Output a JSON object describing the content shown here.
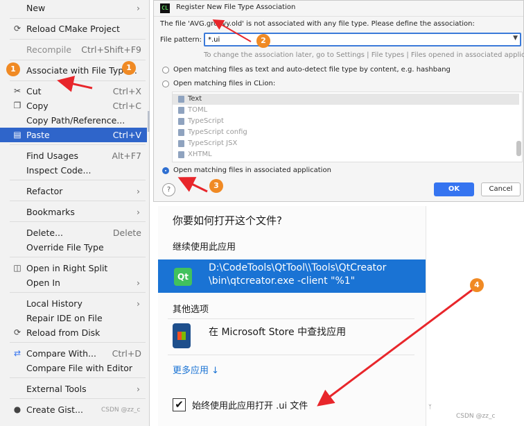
{
  "menu": {
    "items": [
      {
        "label": "New",
        "shortcut": "",
        "icon": "",
        "arrow": false,
        "disabled": false,
        "selected": false
      },
      {
        "label": "Reload CMake Project",
        "shortcut": "",
        "icon": "reload-icon",
        "arrow": false,
        "disabled": false,
        "selected": false
      },
      {
        "label": "Recompile",
        "shortcut": "Ctrl+Shift+F9",
        "icon": "",
        "arrow": false,
        "disabled": true,
        "selected": false
      },
      {
        "label": "Associate with File Type...",
        "shortcut": "",
        "icon": "",
        "arrow": false,
        "disabled": false,
        "selected": false
      },
      {
        "label": "Cut",
        "shortcut": "Ctrl+X",
        "icon": "scissors-icon",
        "arrow": false,
        "disabled": false,
        "selected": false
      },
      {
        "label": "Copy",
        "shortcut": "Ctrl+C",
        "icon": "copy-icon",
        "arrow": false,
        "disabled": false,
        "selected": false
      },
      {
        "label": "Copy Path/Reference...",
        "shortcut": "",
        "icon": "",
        "arrow": false,
        "disabled": false,
        "selected": false
      },
      {
        "label": "Paste",
        "shortcut": "Ctrl+V",
        "icon": "paste-icon",
        "arrow": false,
        "disabled": false,
        "selected": true
      },
      {
        "label": "Find Usages",
        "shortcut": "Alt+F7",
        "icon": "",
        "arrow": false,
        "disabled": false,
        "selected": false
      },
      {
        "label": "Inspect Code...",
        "shortcut": "",
        "icon": "",
        "arrow": false,
        "disabled": false,
        "selected": false
      },
      {
        "label": "Refactor",
        "shortcut": "",
        "icon": "",
        "arrow": true,
        "disabled": false,
        "selected": false
      },
      {
        "label": "Bookmarks",
        "shortcut": "",
        "icon": "",
        "arrow": true,
        "disabled": false,
        "selected": false
      },
      {
        "label": "Delete...",
        "shortcut": "Delete",
        "icon": "",
        "arrow": false,
        "disabled": false,
        "selected": false
      },
      {
        "label": "Override File Type",
        "shortcut": "",
        "icon": "",
        "arrow": false,
        "disabled": false,
        "selected": false
      },
      {
        "label": "Open in Right Split",
        "shortcut": "",
        "icon": "split-icon",
        "arrow": false,
        "disabled": false,
        "selected": false
      },
      {
        "label": "Open In",
        "shortcut": "",
        "icon": "",
        "arrow": true,
        "disabled": false,
        "selected": false
      },
      {
        "label": "Local History",
        "shortcut": "",
        "icon": "",
        "arrow": true,
        "disabled": false,
        "selected": false
      },
      {
        "label": "Repair IDE on File",
        "shortcut": "",
        "icon": "",
        "arrow": false,
        "disabled": false,
        "selected": false
      },
      {
        "label": "Reload from Disk",
        "shortcut": "",
        "icon": "reload-icon",
        "arrow": false,
        "disabled": false,
        "selected": false
      },
      {
        "label": "Compare With...",
        "shortcut": "Ctrl+D",
        "icon": "compare-icon",
        "arrow": false,
        "disabled": false,
        "selected": false
      },
      {
        "label": "Compare File with Editor",
        "shortcut": "",
        "icon": "",
        "arrow": false,
        "disabled": false,
        "selected": false
      },
      {
        "label": "External Tools",
        "shortcut": "",
        "icon": "",
        "arrow": true,
        "disabled": false,
        "selected": false
      },
      {
        "label": "Create Gist...",
        "shortcut": "",
        "icon": "github-icon",
        "arrow": false,
        "disabled": false,
        "selected": false
      }
    ],
    "watermark": "CSDN @zz_c"
  },
  "dialog": {
    "logo": "CL",
    "title": "Register New File Type Association",
    "message": "The file 'AVG.groovy.old' is not associated with any file type. Please define the association:",
    "pattern_label": "File pattern:",
    "pattern_value": "*.ui",
    "hint": "To change the association later, go to Settings | File types | Files opened in associated applications",
    "options": [
      "Open matching files as text and auto-detect file type by content, e.g. hashbang",
      "Open matching files in CLion:",
      "Open matching files in associated application"
    ],
    "file_types": [
      "Text",
      "TOML",
      "TypeScript",
      "TypeScript config",
      "TypeScript JSX",
      "XHTML"
    ],
    "help": "?",
    "ok": "OK",
    "cancel": "Cancel"
  },
  "open_with": {
    "title": "你要如何打开这个文件?",
    "continue_label": "继续使用此应用",
    "app_icon": "Qt",
    "app_path_line1": "D:\\CodeTools\\QtTool\\\\Tools\\QtCreator",
    "app_path_line2": "\\bin\\qtcreator.exe -client \"%1\"",
    "other_label": "其他选项",
    "store_label": "在 Microsoft Store 中查找应用",
    "more_apps": "更多应用 ↓",
    "always_label": "始终使用此应用打开 .ui 文件",
    "always_checked": true,
    "watermark": "CSDN @zz_c"
  },
  "annotations": [
    "1",
    "1",
    "2",
    "3",
    "4"
  ],
  "colors": {
    "accent": "#3574f0",
    "selection": "#2f65ca",
    "badge": "#f08a24",
    "arrow": "#e8262b",
    "windows_blue": "#1a73d4"
  }
}
